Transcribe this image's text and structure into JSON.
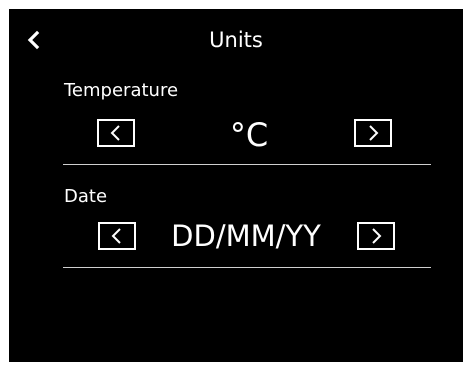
{
  "header": {
    "title": "Units",
    "back_icon": "chevron-left-icon"
  },
  "temperature": {
    "label": "Temperature",
    "value": "°C",
    "prev_icon": "chevron-left-icon",
    "next_icon": "chevron-right-icon"
  },
  "date": {
    "label": "Date",
    "value": "DD/MM/YY",
    "prev_icon": "chevron-left-icon",
    "next_icon": "chevron-right-icon"
  },
  "colors": {
    "background": "#000000",
    "foreground": "#ffffff",
    "divider": "#cfcfcf"
  }
}
